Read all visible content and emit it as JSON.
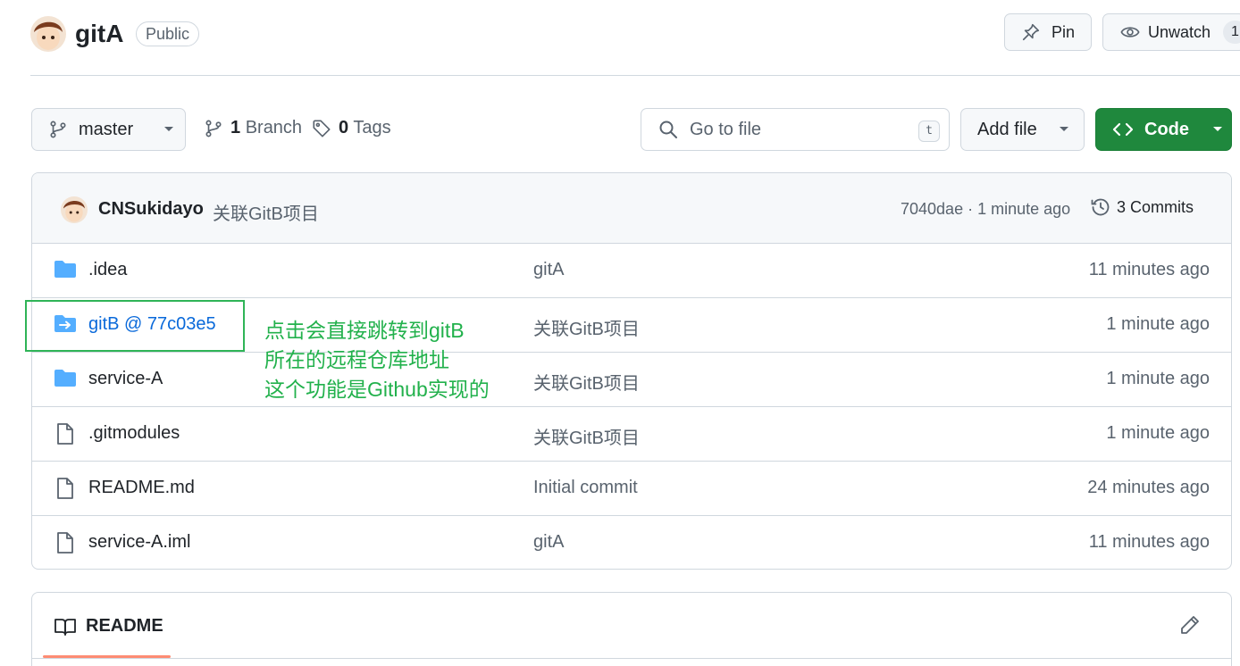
{
  "header": {
    "repo_name": "gitA",
    "visibility": "Public",
    "pin_label": "Pin",
    "watch_label": "Unwatch",
    "watch_count": "1"
  },
  "toolbar": {
    "branch": "master",
    "branch_count": "1",
    "branch_label": "Branch",
    "tag_count": "0",
    "tag_label": "Tags",
    "search_placeholder": "Go to file",
    "search_shortcut": "t",
    "add_file_label": "Add file",
    "code_label": "Code"
  },
  "latest_commit": {
    "author": "CNSukidayo",
    "message": "关联GitB项目",
    "meta": "7040dae · 1 minute ago",
    "commits_label": "3 Commits"
  },
  "files": [
    {
      "name": ".idea",
      "type": "folder",
      "message": "gitA",
      "age": "11 minutes ago"
    },
    {
      "name": "gitB @ 77c03e5",
      "type": "submodule",
      "message": "关联GitB项目",
      "age": "1 minute ago"
    },
    {
      "name": "service-A",
      "type": "folder",
      "message": "关联GitB项目",
      "age": "1 minute ago"
    },
    {
      "name": ".gitmodules",
      "type": "file",
      "message": "关联GitB项目",
      "age": "1 minute ago"
    },
    {
      "name": "README.md",
      "type": "file",
      "message": "Initial commit",
      "age": "24 minutes ago"
    },
    {
      "name": "service-A.iml",
      "type": "file",
      "message": "gitA",
      "age": "11 minutes ago"
    }
  ],
  "annotation": {
    "lines": [
      "点击会直接跳转到gitB",
      "所在的远程仓库地址",
      "这个功能是Github实现的"
    ],
    "color": "#22b14c"
  },
  "readme": {
    "label": "README"
  },
  "colors": {
    "accent_link": "#0969da",
    "code_button": "#1f883d",
    "folder_icon": "#54aeff",
    "tab_underline": "#fd8c73"
  }
}
